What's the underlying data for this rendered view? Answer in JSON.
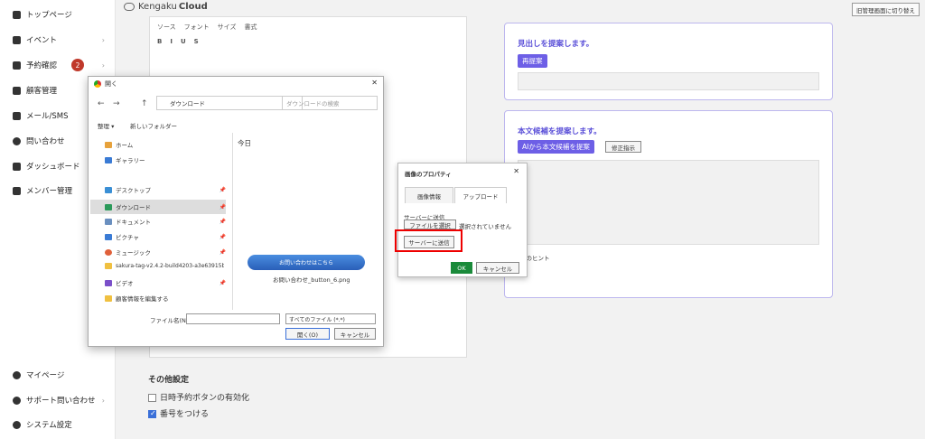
{
  "sidebar": {
    "items": [
      {
        "label": "トップページ"
      },
      {
        "label": "イベント"
      },
      {
        "label": "予約確認"
      },
      {
        "label": "顧客管理"
      },
      {
        "label": "メール/SMS"
      },
      {
        "label": "問い合わせ"
      },
      {
        "label": "ダッシュボード"
      },
      {
        "label": "メンバー管理"
      }
    ],
    "bottom": [
      {
        "label": "マイページ"
      },
      {
        "label": "サポート問い合わせ"
      },
      {
        "label": "システム設定"
      }
    ],
    "badge": "2"
  },
  "header": {
    "logo": "Kengaku",
    "logo_bold": "Cloud",
    "switch_label": "旧管理画面に切り替え"
  },
  "editor": {
    "toolbar1": [
      "ソース",
      "フォント",
      "サイズ",
      "書式"
    ],
    "toolbar2": [
      "B",
      "I",
      "U",
      "S"
    ]
  },
  "cards": [
    {
      "title": "見出しを提案します。",
      "button": "再提案"
    },
    {
      "title": "本文候補を提案します。",
      "button": "AIから本文候補を提案",
      "button2": "修正指示"
    }
  ],
  "hint": "像のヒント",
  "other": {
    "title": "その他設定",
    "opt1": "日時予約ボタンの有効化",
    "opt2": "番号をつける"
  },
  "file_dialog": {
    "title": "開く",
    "path": "ダウンロード",
    "search_placeholder": "ダウンロードの検索",
    "organize": "整理 ▾",
    "new_folder": "新しいフォルダー",
    "tree": [
      "ホーム",
      "ギャラリー",
      "デスクトップ",
      "ダウンロード",
      "ドキュメント",
      "ピクチャ",
      "ミュージック",
      "sakura-tag-v2.4.2-build4203-a3e63915b-",
      "ビデオ",
      "顧客情報を編集する"
    ],
    "group": "今日",
    "thumb_label": "お問い合わせはこちら",
    "file_name": "お問い合わせ_button_6.png",
    "fname_label": "ファイル名(N):",
    "filter": "すべてのファイル (*.*)",
    "open": "開く(O)",
    "cancel": "キャンセル"
  },
  "prop_dialog": {
    "title": "画像のプロパティ",
    "tab1": "画像情報",
    "tab2": "アップロード",
    "server_label": "サーバーに送信",
    "choose": "ファイルを選択",
    "none": "選択されていません",
    "send": "サーバーに送信",
    "ok": "OK",
    "cancel": "キャンセル"
  }
}
